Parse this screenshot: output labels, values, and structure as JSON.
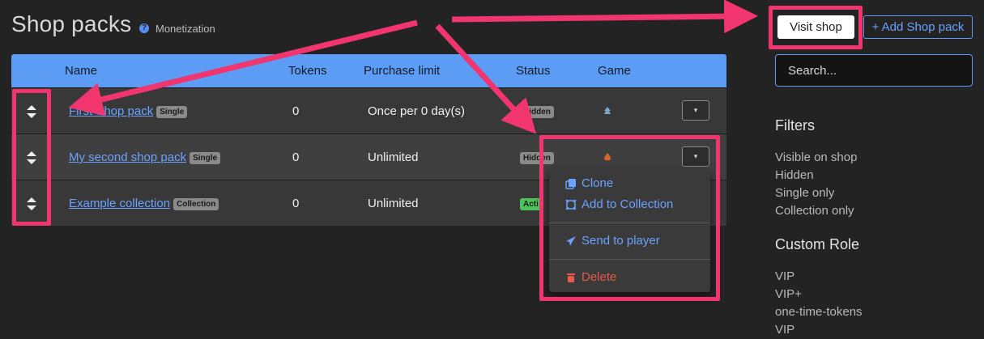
{
  "header": {
    "title": "Shop packs",
    "breadcrumb": "Monetization"
  },
  "table": {
    "columns": [
      "Name",
      "Tokens",
      "Purchase limit",
      "Status",
      "Game"
    ],
    "rows": [
      {
        "name": "First Shop pack",
        "type": "Single",
        "tokens": "0",
        "limit": "Once per 0 day(s)",
        "status": "Hidden"
      },
      {
        "name": "My second shop pack",
        "type": "Single",
        "tokens": "0",
        "limit": "Unlimited",
        "status": "Hidden"
      },
      {
        "name": "Example collection",
        "type": "Collection",
        "tokens": "0",
        "limit": "Unlimited",
        "status": "Acti"
      }
    ]
  },
  "row_menu": {
    "clone": "Clone",
    "add_to_collection": "Add to Collection",
    "send_to_player": "Send to player",
    "delete": "Delete"
  },
  "sidebar": {
    "visit_shop": "Visit shop",
    "add_pack": "+ Add Shop pack",
    "search_placeholder": "Search...",
    "filters_heading": "Filters",
    "filters": [
      "Visible on shop",
      "Hidden",
      "Single only",
      "Collection only"
    ],
    "custom_role_heading": "Custom Role",
    "roles": [
      "VIP",
      "VIP+",
      "one-time-tokens",
      "VIP"
    ]
  },
  "colors": {
    "accent": "#5c9cf5",
    "link": "#6aa2ff",
    "highlight": "#f0356f",
    "danger": "#e85a4a",
    "active": "#4cc35a"
  }
}
